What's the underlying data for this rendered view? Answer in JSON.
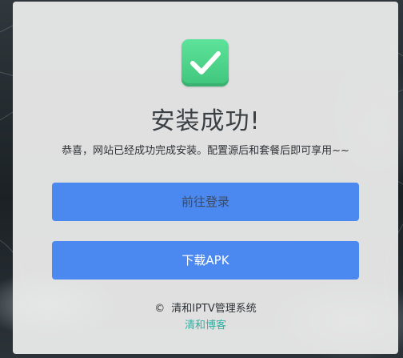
{
  "success": {
    "title": "安装成功!",
    "message": "恭喜，网站已经成功完成安装。配置源后和套餐后即可享用~~"
  },
  "buttons": {
    "login_label": "前往登录",
    "apk_label": "下载APK"
  },
  "footer": {
    "copyright_symbol": "©",
    "system_name": "清和IPTV管理系统",
    "blog_link": "清和博客"
  },
  "colors": {
    "accent_blue": "#4b89f0",
    "success_green": "#4fd48b",
    "link_teal": "#2bb3a3"
  },
  "icons": {
    "success": "checkmark-icon"
  }
}
